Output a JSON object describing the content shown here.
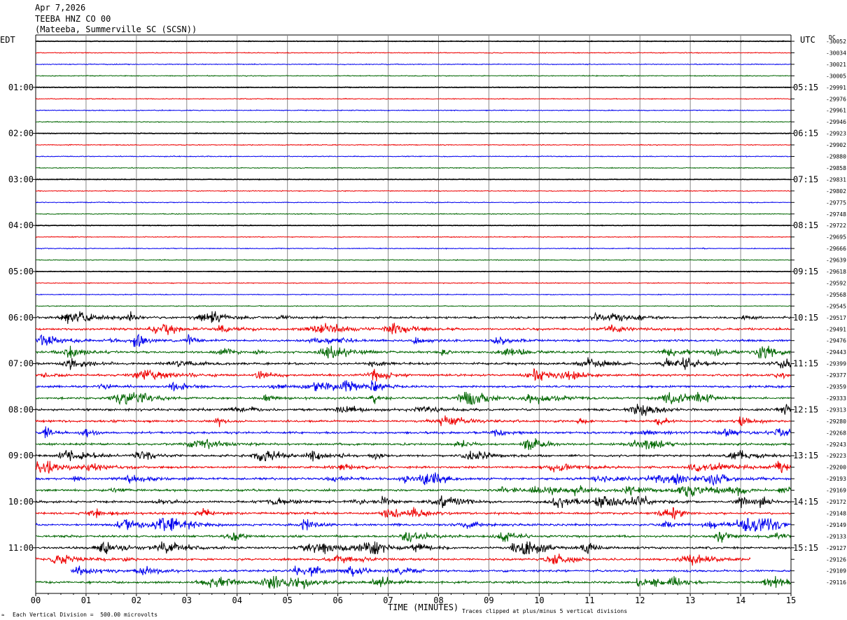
{
  "header": {
    "date": "Apr 7,2026",
    "station": "TEEBA HNZ CO 00",
    "location": "(Mateeba, Summerville SC (SCSN))"
  },
  "left_tz": "EDT",
  "right_tz": "UTC",
  "dc_label": "DC",
  "footer": {
    "note_left": "Each Vertical Division =  500.00 microvolts",
    "note_right": "Traces clipped at plus/minus 5 vertical divisions",
    "logo_mark": "≈"
  },
  "colors": {
    "trace_cycle": [
      "#000000",
      "#ee0000",
      "#0000ee",
      "#006600"
    ],
    "grid": "#888888"
  },
  "chart_data": {
    "type": "line",
    "title": "TEEBA HNZ CO 00",
    "xlabel": "TIME (MINUTES)",
    "ylabel": "",
    "xlim": [
      0,
      15
    ],
    "x_ticks": [
      "00",
      "01",
      "02",
      "03",
      "04",
      "05",
      "06",
      "07",
      "08",
      "09",
      "10",
      "11",
      "12",
      "13",
      "14",
      "15"
    ],
    "left_hour_labels": [
      "01:00",
      "02:00",
      "03:00",
      "04:00",
      "05:00",
      "06:00",
      "07:00",
      "08:00",
      "09:00",
      "10:00",
      "11:00"
    ],
    "right_hour_labels": [
      "05:15",
      "06:15",
      "07:15",
      "08:15",
      "09:15",
      "10:15",
      "11:15",
      "12:15",
      "13:15",
      "14:15",
      "15:15"
    ],
    "hour_label_rows": [
      4,
      8,
      12,
      16,
      20,
      24,
      28,
      32,
      36,
      40,
      44
    ],
    "dc_offsets": [
      "-30052",
      "-30034",
      "-30021",
      "-30005",
      "-29991",
      "-29976",
      "-29961",
      "-29946",
      "-29923",
      "-29902",
      "-29880",
      "-29858",
      "-29831",
      "-29802",
      "-29775",
      "-29748",
      "-29722",
      "-29695",
      "-29666",
      "-29639",
      "-29618",
      "-29592",
      "-29568",
      "-29545",
      "-29517",
      "-29491",
      "-29476",
      "-29443",
      "-29399",
      "-29377",
      "-29359",
      "-29333",
      "-29313",
      "-29280",
      "-29268",
      "-29243",
      "-29223",
      "-29200",
      "-29193",
      "-29169",
      "-29172",
      "-29148",
      "-29149",
      "-29133",
      "-29127",
      "-29126",
      "-29109",
      "-29116"
    ],
    "trace_count": 48,
    "minutes_per_trace": 15,
    "active_from_trace": 24,
    "last_trace_truncated_at_minute": 14.2,
    "last_trace_start_minute": 0.7
  }
}
